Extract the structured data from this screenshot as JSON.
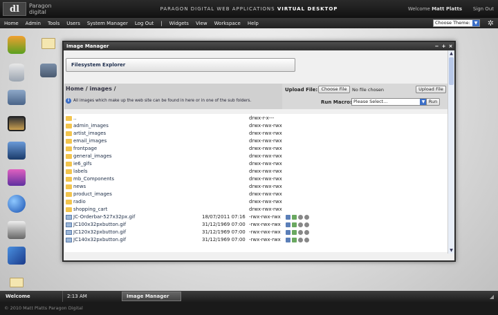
{
  "header": {
    "logo_mark": "dl",
    "logo_line1": "Paragon",
    "logo_line2": "digital",
    "title_prefix": "PARAGON DIGITAL WEB APPLICATIONS",
    "title_bold": "VIRTUAL DESKTOP",
    "welcome_prefix": "Welcome",
    "welcome_name": "Matt Platts",
    "sign_out": "Sign Out"
  },
  "menu": [
    "Home",
    "Admin",
    "Tools",
    "Users",
    "System Manager",
    "Log Out",
    "|",
    "Widgets",
    "View",
    "Workspace",
    "Help"
  ],
  "theme": {
    "value": "Choose Theme:"
  },
  "window": {
    "title": "Image Manager",
    "controls": [
      "−",
      "+",
      "×"
    ],
    "fs_button": "Filesystem Explorer",
    "path_root": "Home",
    "path_sep": "/",
    "path_dir": "images",
    "path_end": "/",
    "info": "All images which make up the web site can be found in here or in one of the sub folders.",
    "upload_label": "Upload File:",
    "choose_file": "Choose File",
    "no_file": "No file chosen",
    "upload_button": "Upload File",
    "macro_label": "Run Macro:",
    "macro_value": "Please Select...",
    "run_button": "Run"
  },
  "files": [
    {
      "type": "folder",
      "name": "..",
      "date": "",
      "perms": "drwx-r-x---"
    },
    {
      "type": "folder",
      "name": "admin_images",
      "date": "",
      "perms": "drwx-rwx-rwx"
    },
    {
      "type": "folder",
      "name": "artist_images",
      "date": "",
      "perms": "drwx-rwx-rwx"
    },
    {
      "type": "folder",
      "name": "email_images",
      "date": "",
      "perms": "drwx-rwx-rwx"
    },
    {
      "type": "folder",
      "name": "frontpage",
      "date": "",
      "perms": "drwx-rwx-rwx"
    },
    {
      "type": "folder",
      "name": "general_images",
      "date": "",
      "perms": "drwx-rwx-rwx"
    },
    {
      "type": "folder",
      "name": "ie6_gifs",
      "date": "",
      "perms": "drwx-rwx-rwx"
    },
    {
      "type": "folder",
      "name": "labels",
      "date": "",
      "perms": "drwx-rwx-rwx"
    },
    {
      "type": "folder",
      "name": "mb_Components",
      "date": "",
      "perms": "drwx-rwx-rwx"
    },
    {
      "type": "folder",
      "name": "news",
      "date": "",
      "perms": "drwx-rwx-rwx"
    },
    {
      "type": "folder",
      "name": "product_images",
      "date": "",
      "perms": "drwx-rwx-rwx"
    },
    {
      "type": "folder",
      "name": "radio",
      "date": "",
      "perms": "drwx-rwx-rwx"
    },
    {
      "type": "folder",
      "name": "shopping_cart",
      "date": "",
      "perms": "drwx-rwx-rwx"
    },
    {
      "type": "gif",
      "name": "JC-Orderbar-527x32px.gif",
      "date": "18/07/2011 07:16",
      "perms": "-rwx-rwx-rwx"
    },
    {
      "type": "gif",
      "name": "JC100x32pxbutton.gif",
      "date": "31/12/1969 07:00",
      "perms": "-rwx-rwx-rwx"
    },
    {
      "type": "gif",
      "name": "JC120x32pxbutton.gif",
      "date": "31/12/1969 07:00",
      "perms": "-rwx-rwx-rwx"
    },
    {
      "type": "gif",
      "name": "JC140x32pxbutton.gif",
      "date": "31/12/1969 07:00",
      "perms": "-rwx-rwx-rwx"
    }
  ],
  "taskbar": {
    "welcome": "Welcome",
    "time": "2:13 AM",
    "task": "Image Manager"
  },
  "footer": "© 2010 Matt Platts Paragon Digital",
  "colors": {
    "accent": "#3b6fc8",
    "folder": "#f2c44d",
    "window_title": "#3a3a3a"
  }
}
